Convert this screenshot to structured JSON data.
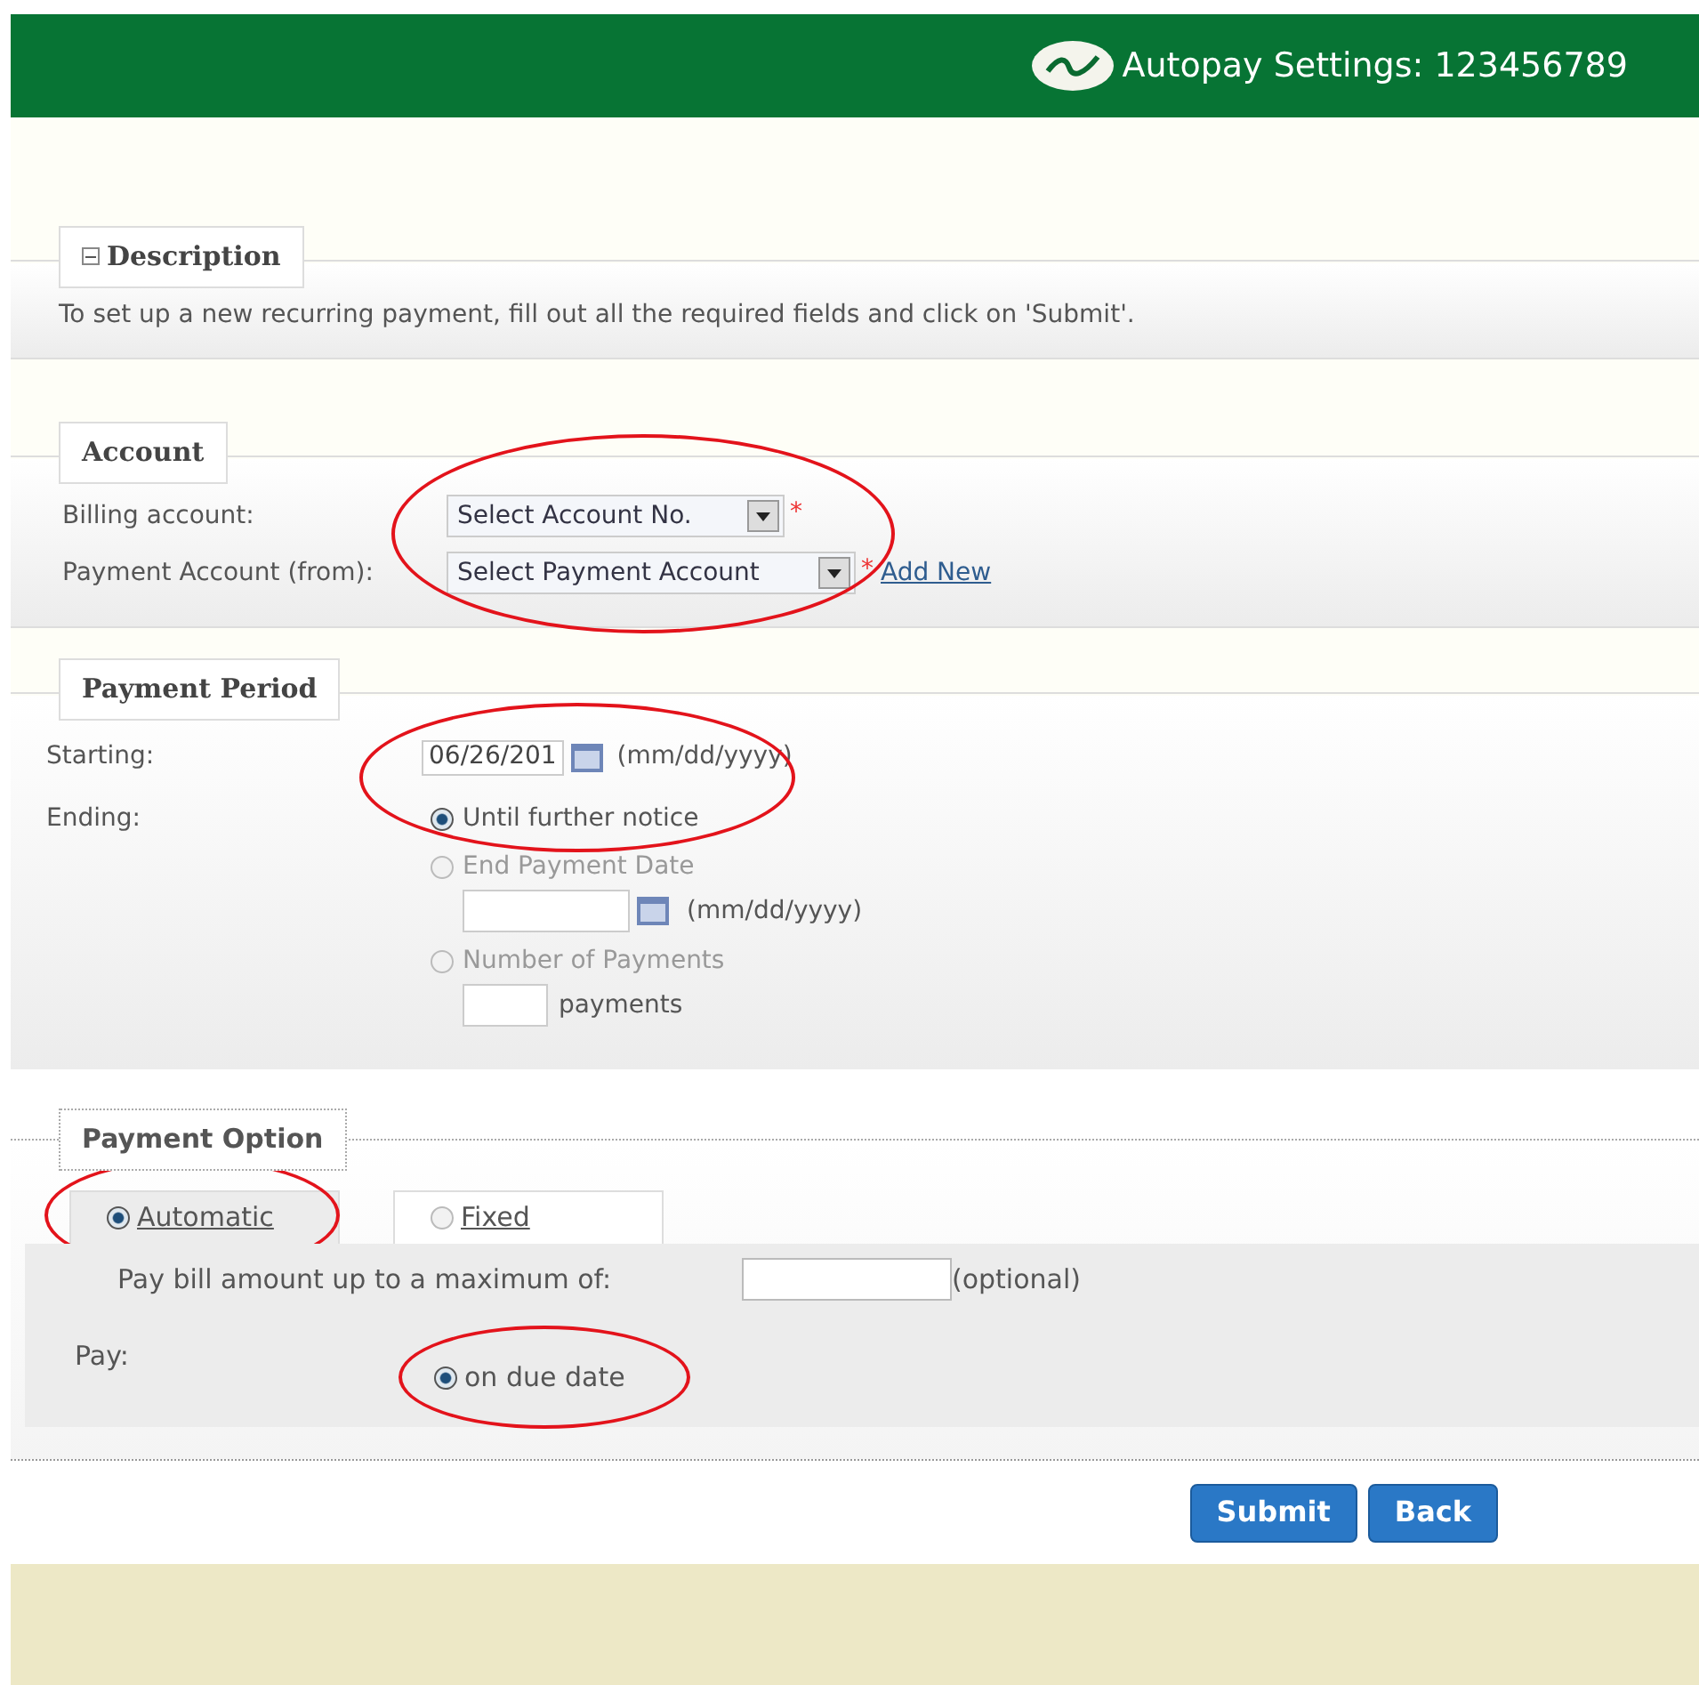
{
  "header": {
    "title": "Autopay Settings: 123456789"
  },
  "description": {
    "legend": "Description",
    "expanded": true,
    "text": "To set up a new recurring payment, fill out all the required fields and click on 'Submit'."
  },
  "account": {
    "legend": "Account",
    "circled": true,
    "fields": [
      {
        "label": "Billing account:",
        "value": "Select Account No.",
        "required": "*"
      },
      {
        "label": "Payment Account (from):",
        "value": "Select Payment Account",
        "required": "*",
        "link": "Add New"
      }
    ]
  },
  "period": {
    "legend": "Payment Period",
    "circled": true,
    "start_label": "Starting:",
    "start_value": "06/26/201",
    "start_hint": "(mm/dd/yyyy)",
    "end_label": "Ending:",
    "options": [
      {
        "kind": "plain",
        "label": "Until further notice",
        "selected": true
      },
      {
        "kind": "date",
        "label": "End Payment Date",
        "hint": "(mm/dd/yyyy)",
        "selected": false
      },
      {
        "kind": "count",
        "label": "Number of Payments",
        "unit": "payments",
        "selected": false
      }
    ]
  },
  "payment_option": {
    "legend": "Payment Option",
    "tabs": [
      {
        "label": "Automatic",
        "selected": true,
        "circled": true
      },
      {
        "label": "Fixed",
        "selected": false,
        "circled": false
      }
    ],
    "max_label": "Pay bill amount up to a maximum of:",
    "max_hint": "(optional)",
    "pay_label": "Pay:",
    "pay_options": [
      {
        "label": "on due date",
        "selected": true,
        "circled": true
      }
    ]
  },
  "buttons": [
    "Submit",
    "Back"
  ]
}
